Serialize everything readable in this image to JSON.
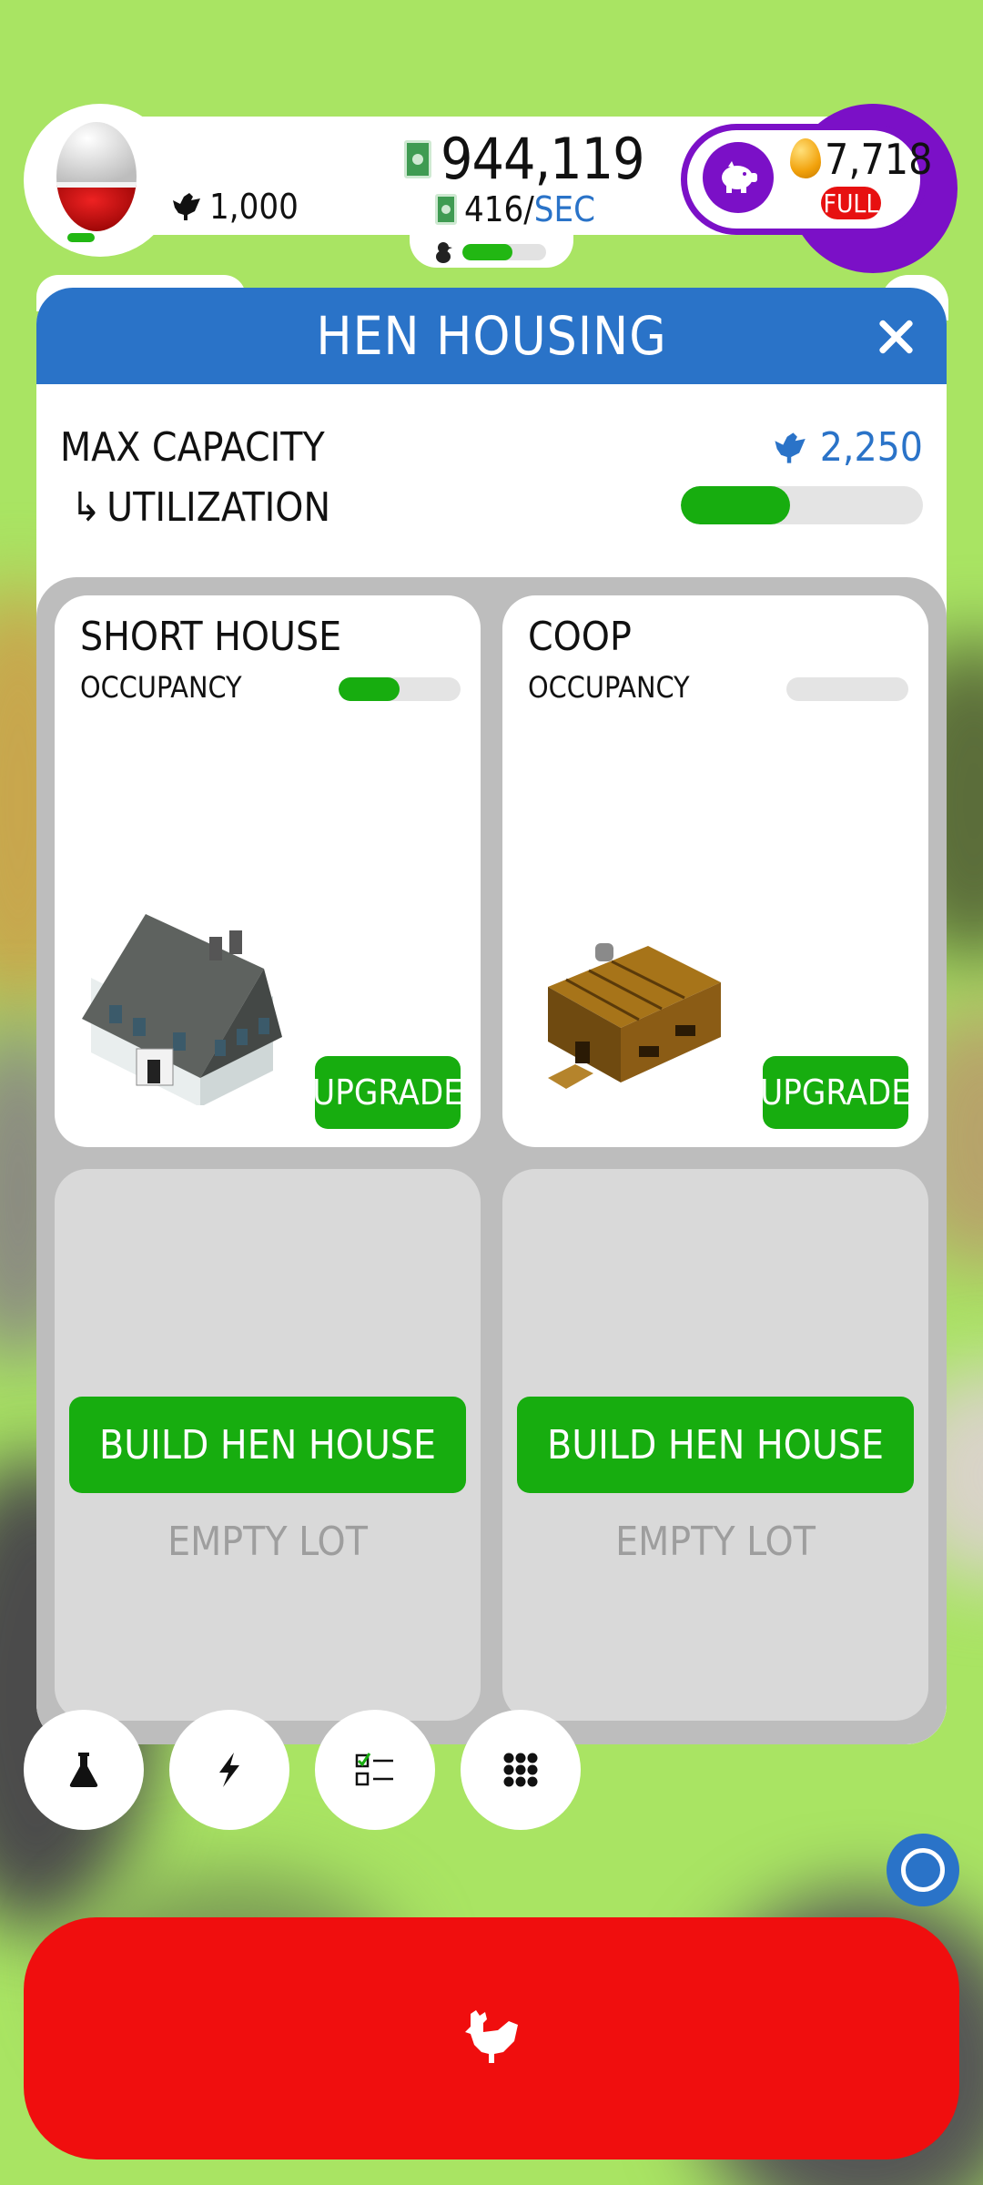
{
  "hud": {
    "hen_count": "1,000",
    "money": "944,119",
    "rate_value": "416/",
    "rate_unit": "SEC",
    "gold_eggs": "7,718",
    "full_badge": "FULL",
    "habitat_fill": 0.6
  },
  "modal": {
    "title": "HEN HOUSING",
    "max_capacity_label": "MAX CAPACITY",
    "max_capacity_value": "2,250",
    "utilization_label": "UTILIZATION",
    "utilization_arrow": "↳",
    "utilization_fill": 0.45
  },
  "lots": [
    {
      "name": "SHORT HOUSE",
      "occupancy_label": "OCCUPANCY",
      "occupancy_fill": 0.5,
      "button": "UPGRADE"
    },
    {
      "name": "COOP",
      "occupancy_label": "OCCUPANCY",
      "occupancy_fill": 0.0,
      "button": "UPGRADE"
    },
    {
      "button": "BUILD HEN HOUSE",
      "status": "EMPTY LOT"
    },
    {
      "button": "BUILD HEN HOUSE",
      "status": "EMPTY LOT"
    }
  ],
  "toolbar": {
    "icons": [
      "flask-icon",
      "lightning-icon",
      "checklist-icon",
      "grid-icon",
      "ring-icon",
      "chicken-icon"
    ]
  },
  "colors": {
    "background": "#a9e463",
    "header_blue": "#2a73c8",
    "button_green": "#17ad0f",
    "hatch_red": "#f00e0e",
    "purple": "#7b10c7"
  }
}
